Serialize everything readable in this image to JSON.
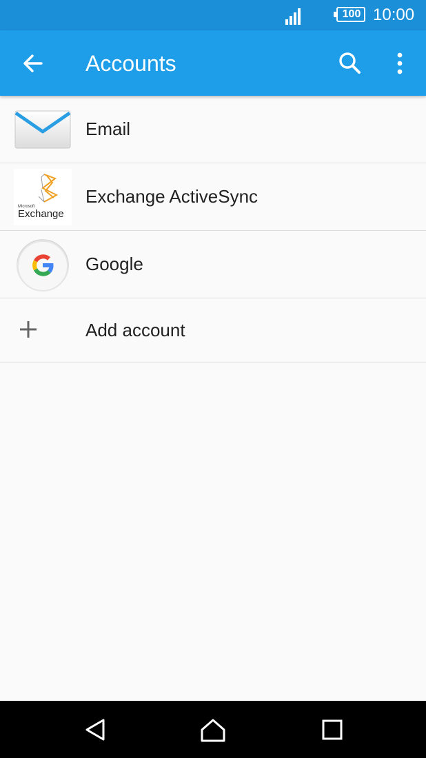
{
  "status_bar": {
    "battery": "100",
    "time": "10:00"
  },
  "app_bar": {
    "title": "Accounts",
    "back_icon": "arrow-back-icon",
    "search_icon": "search-icon",
    "overflow_icon": "more-vert-icon"
  },
  "accounts": {
    "items": [
      {
        "label": "Email",
        "icon": "email-envelope-icon"
      },
      {
        "label": "Exchange ActiveSync",
        "icon": "microsoft-exchange-logo",
        "logo_text": "Microsoft Exchange"
      },
      {
        "label": "Google",
        "icon": "google-logo"
      }
    ],
    "add_label": "Add account",
    "add_icon": "plus-icon"
  },
  "nav_bar": {
    "back_icon": "nav-back-icon",
    "home_icon": "nav-home-icon",
    "recents_icon": "nav-recents-icon"
  },
  "colors": {
    "status_bar": "#1b8fd8",
    "app_bar": "#1e9ee8",
    "background": "#fafafa",
    "divider": "#dcdcdc",
    "nav_bar": "#000000"
  }
}
